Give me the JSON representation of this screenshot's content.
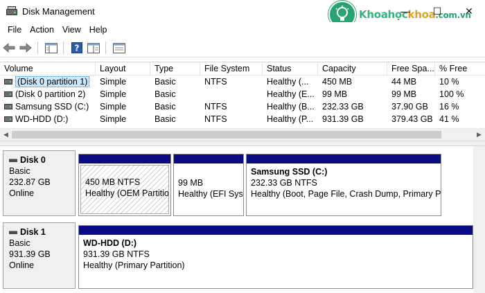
{
  "window": {
    "title": "Disk Management",
    "minimize": "—",
    "maximize": "☐",
    "close": "✕"
  },
  "watermark": {
    "part1": "Khoa",
    "part2": "học",
    "part3": "khoa",
    "suffix": ".com.vn"
  },
  "menu": [
    "File",
    "Action",
    "View",
    "Help"
  ],
  "toolbar": {
    "icons": [
      "back-arrow-icon",
      "forward-arrow-icon",
      "show-hide-console-tree-icon",
      "help-icon",
      "properties-icon",
      "export-list-icon"
    ]
  },
  "volume_table": {
    "columns": [
      "Volume",
      "Layout",
      "Type",
      "File System",
      "Status",
      "Capacity",
      "Free Spa...",
      "% Free"
    ],
    "rows": [
      [
        "(Disk 0 partition 1)",
        "Simple",
        "Basic",
        "NTFS",
        "Healthy (...",
        "450 MB",
        "44 MB",
        "10 %"
      ],
      [
        "(Disk 0 partition 2)",
        "Simple",
        "Basic",
        "",
        "Healthy (E...",
        "99 MB",
        "99 MB",
        "100 %"
      ],
      [
        "Samsung SSD (C:)",
        "Simple",
        "Basic",
        "NTFS",
        "Healthy (B...",
        "232.33 GB",
        "37.90 GB",
        "16 %"
      ],
      [
        "WD-HDD (D:)",
        "Simple",
        "Basic",
        "NTFS",
        "Healthy (P...",
        "931.39 GB",
        "379.43 GB",
        "41 %"
      ]
    ],
    "selected_row": 0
  },
  "disks": [
    {
      "name": "Disk 0",
      "type": "Basic",
      "size": "232.87 GB",
      "status": "Online",
      "partitions": [
        {
          "name": "",
          "size_fs": "450 MB NTFS",
          "status": "Healthy (OEM Partitio"
        },
        {
          "name": "",
          "size_fs": "99 MB",
          "status": "Healthy (EFI Sys"
        },
        {
          "name": "Samsung SSD  (C:)",
          "size_fs": "232.33 GB NTFS",
          "status": "Healthy (Boot, Page File, Crash Dump, Primary P"
        }
      ]
    },
    {
      "name": "Disk 1",
      "type": "Basic",
      "size": "931.39 GB",
      "status": "Online",
      "partitions": [
        {
          "name": "WD-HDD  (D:)",
          "size_fs": "931.39 GB NTFS",
          "status": "Healthy (Primary Partition)"
        }
      ]
    }
  ],
  "colors": {
    "partition_bar": "#0a0a82",
    "selection": "#cce8ff"
  }
}
